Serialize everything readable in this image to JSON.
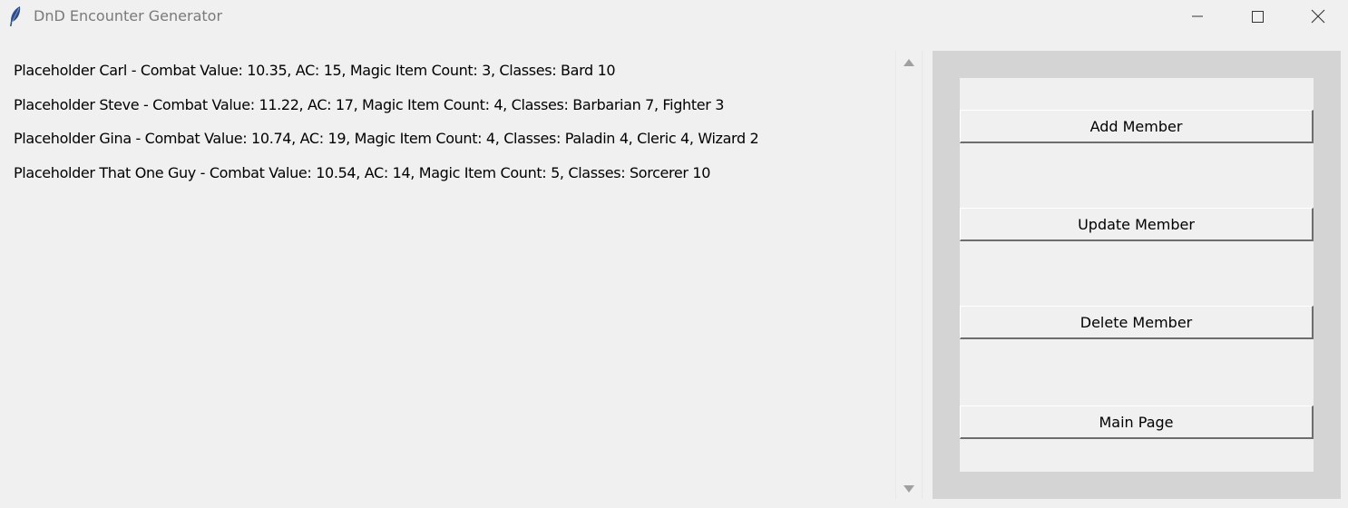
{
  "window": {
    "title": "DnD Encounter Generator",
    "icon": "feather-icon",
    "controls": [
      "minimize-icon",
      "maximize-icon",
      "close-icon"
    ]
  },
  "members": [
    "Placeholder Carl - Combat Value: 10.35, AC: 15, Magic Item Count: 3, Classes: Bard 10",
    "Placeholder Steve - Combat Value: 11.22, AC: 17, Magic Item Count: 4, Classes: Barbarian 7, Fighter 3",
    "Placeholder Gina - Combat Value: 10.74, AC: 19, Magic Item Count: 4, Classes: Paladin 4, Cleric 4, Wizard 2",
    "Placeholder That One Guy - Combat Value: 10.54, AC: 14, Magic Item Count: 5, Classes: Sorcerer 10"
  ],
  "buttons": {
    "add": "Add Member",
    "update": "Update Member",
    "delete": "Delete Member",
    "main": "Main Page"
  },
  "colors": {
    "background": "#f0f0f0",
    "panel_frame": "#d4d4d4",
    "button_shadow": "#6d6d6d"
  }
}
